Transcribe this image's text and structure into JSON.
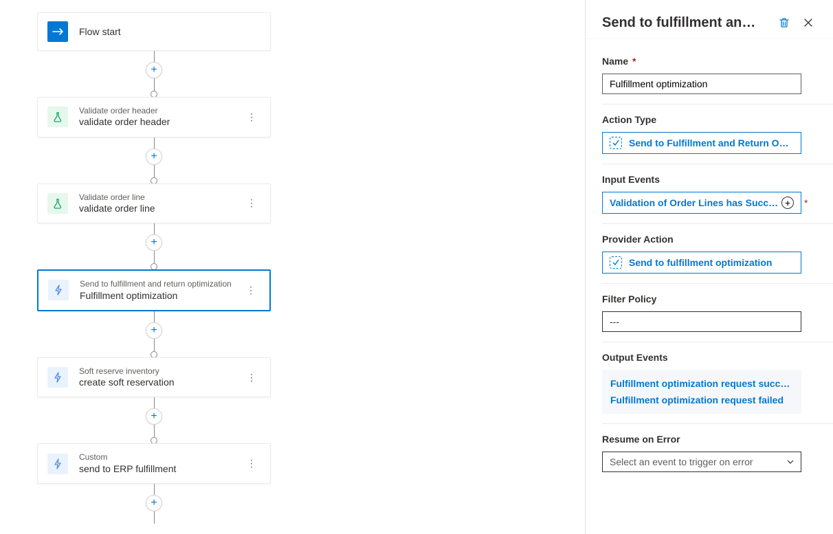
{
  "flow": {
    "start_label": "Flow start",
    "steps": [
      {
        "icon": "flask",
        "type": "Validate order header",
        "title": "validate order header",
        "selected": false
      },
      {
        "icon": "flask",
        "type": "Validate order line",
        "title": "validate order line",
        "selected": false
      },
      {
        "icon": "bolt",
        "type": "Send to fulfillment and return optimization",
        "title": "Fulfillment optimization",
        "selected": true
      },
      {
        "icon": "bolt",
        "type": "Soft reserve inventory",
        "title": "create soft reservation",
        "selected": false
      },
      {
        "icon": "bolt",
        "type": "Custom",
        "title": "send to ERP fulfillment",
        "selected": false
      }
    ]
  },
  "panel": {
    "title": "Send to fulfillment an…",
    "name_label": "Name",
    "name_value": "Fulfillment optimization",
    "action_type_label": "Action Type",
    "action_type_value": "Send to Fulfillment and Return Optimiza…",
    "input_events_label": "Input Events",
    "input_events_value": "Validation of Order Lines has Succeed…",
    "provider_action_label": "Provider Action",
    "provider_action_value": "Send to fulfillment optimization",
    "filter_policy_label": "Filter Policy",
    "filter_policy_value": "---",
    "output_events_label": "Output Events",
    "output_events": [
      "Fulfillment optimization request succ…",
      "Fulfillment optimization request failed"
    ],
    "resume_label": "Resume on Error",
    "resume_placeholder": "Select an event to trigger on error"
  }
}
